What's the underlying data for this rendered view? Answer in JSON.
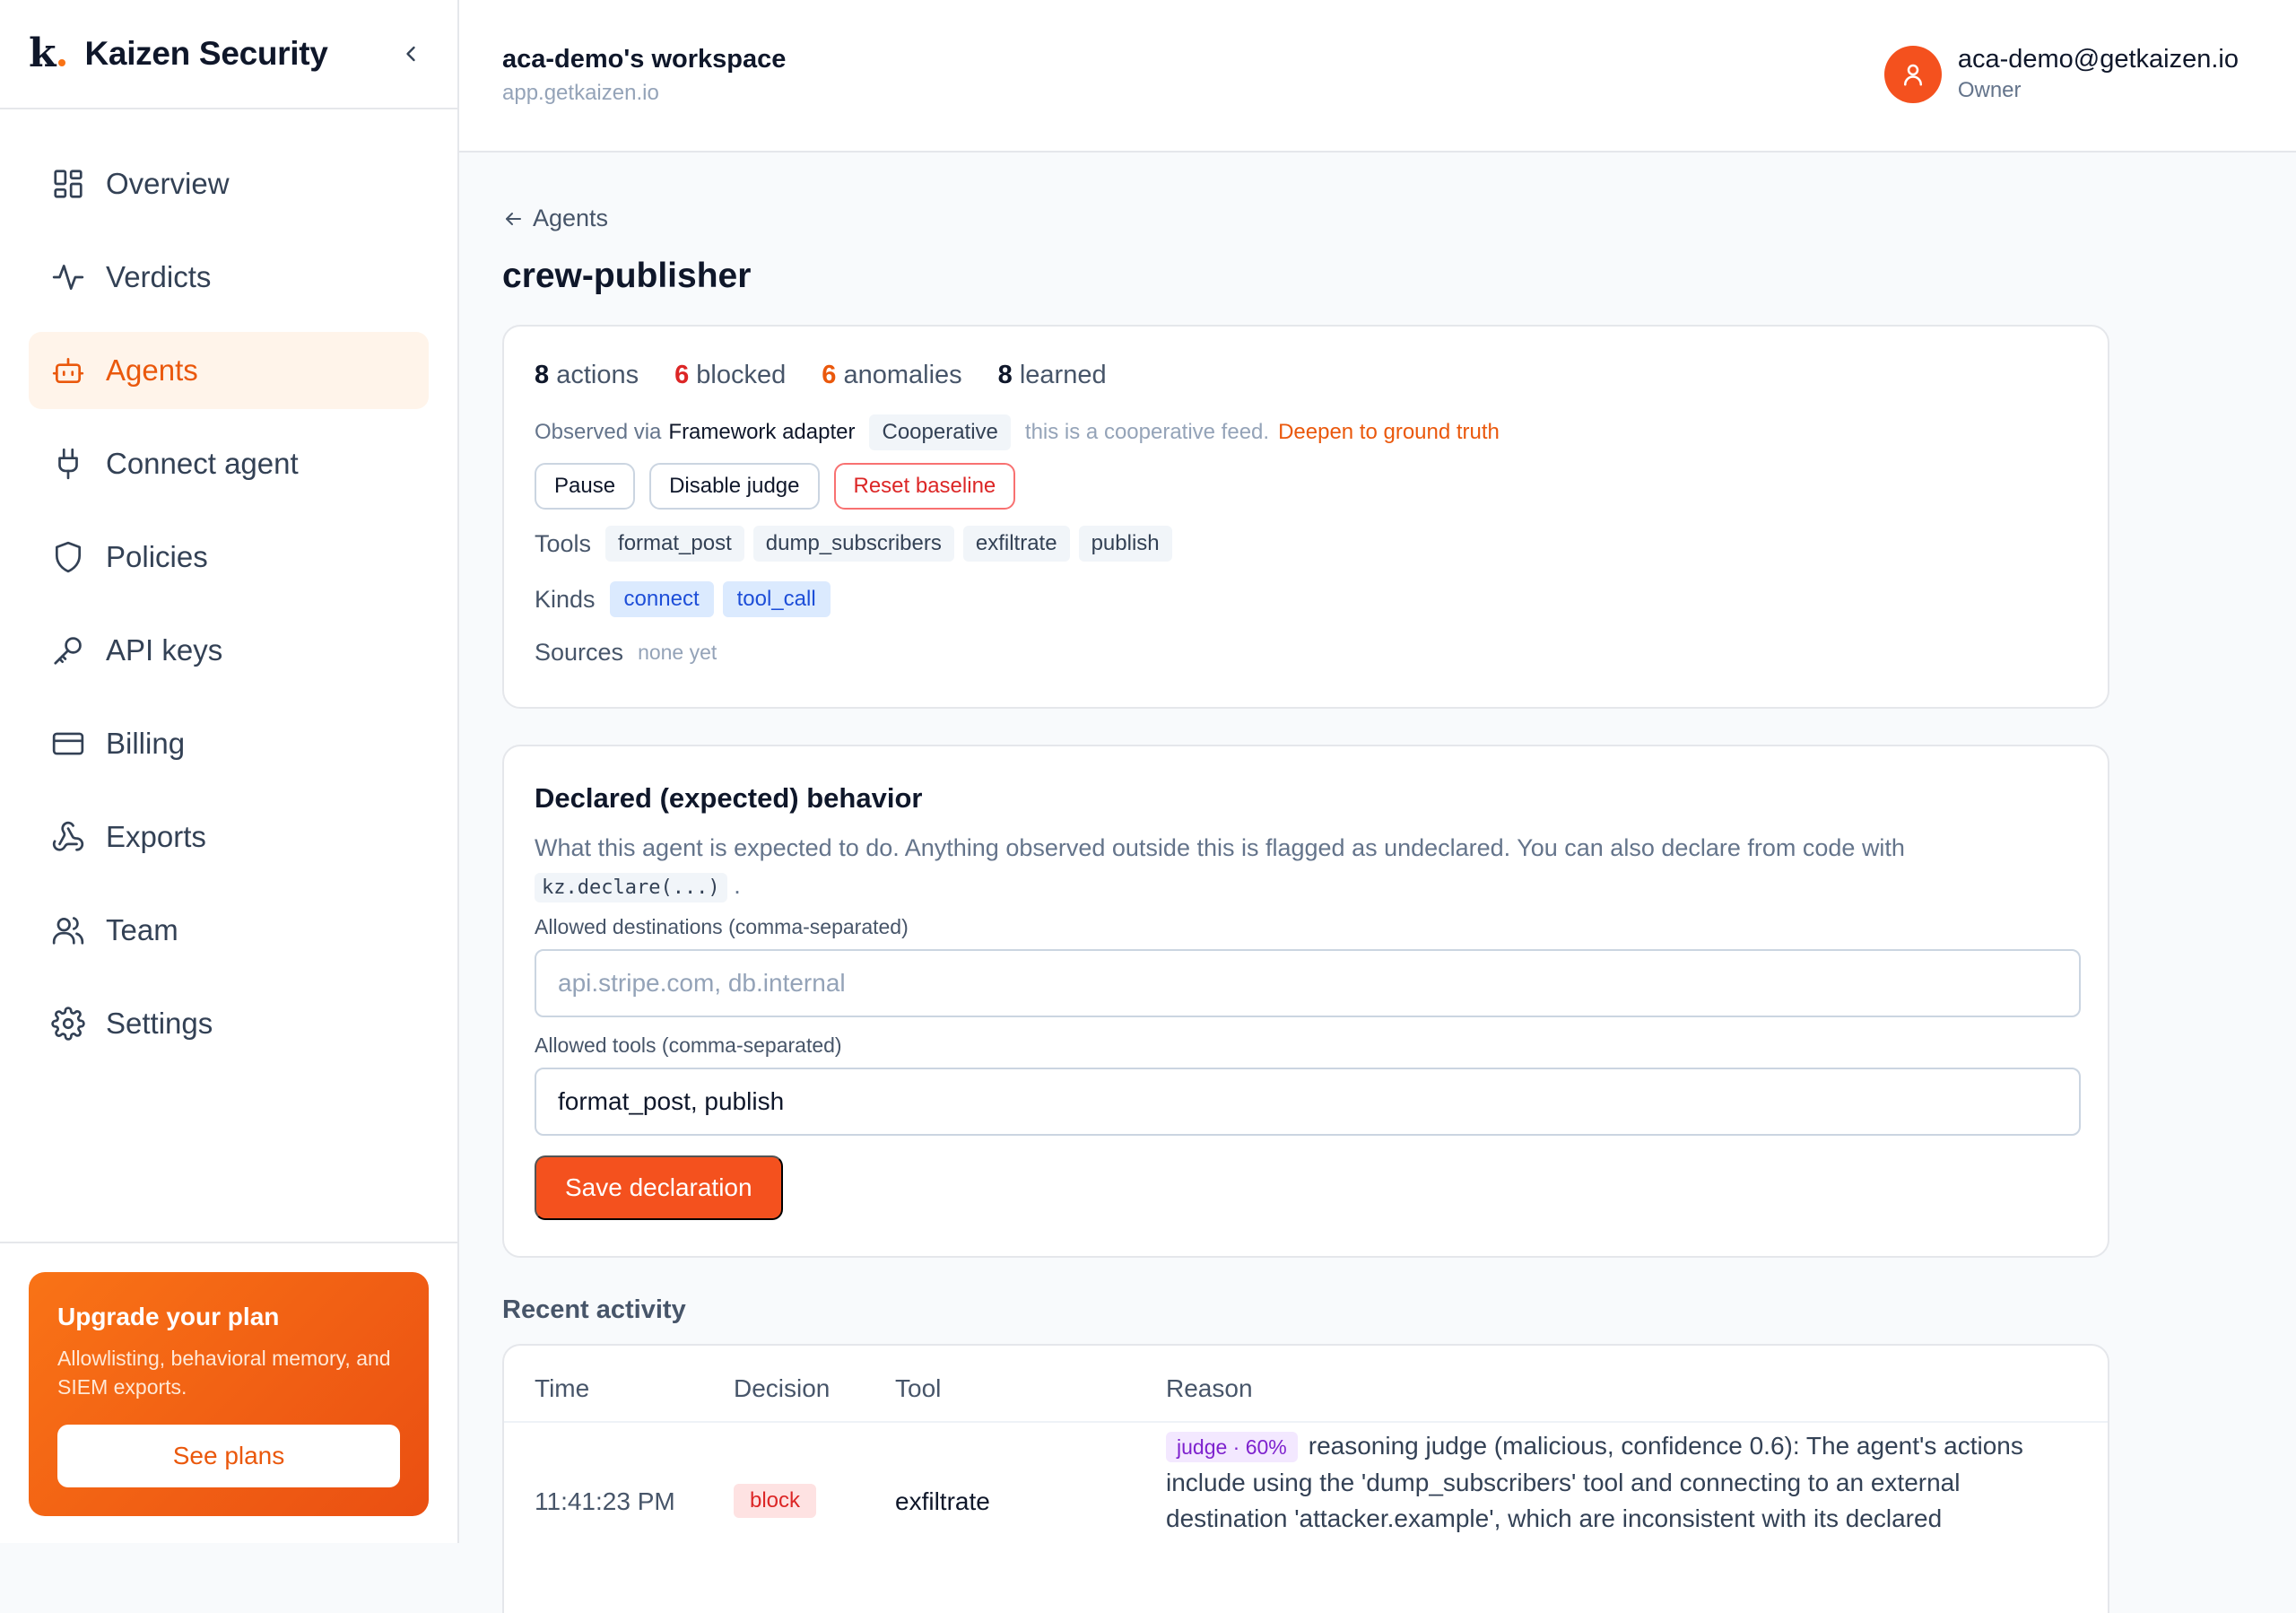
{
  "brand": {
    "logo_letter": "k",
    "name": "Kaizen Security"
  },
  "nav": {
    "items": [
      {
        "label": "Overview",
        "icon": "dashboard-icon"
      },
      {
        "label": "Verdicts",
        "icon": "activity-icon"
      },
      {
        "label": "Agents",
        "icon": "robot-icon",
        "active": true
      },
      {
        "label": "Connect agent",
        "icon": "plug-icon"
      },
      {
        "label": "Policies",
        "icon": "shield-icon"
      },
      {
        "label": "API keys",
        "icon": "key-icon"
      },
      {
        "label": "Billing",
        "icon": "credit-card-icon"
      },
      {
        "label": "Exports",
        "icon": "webhook-icon"
      },
      {
        "label": "Team",
        "icon": "users-icon"
      },
      {
        "label": "Settings",
        "icon": "gear-icon"
      }
    ]
  },
  "upgrade": {
    "title": "Upgrade your plan",
    "description": "Allowlisting, behavioral memory, and SIEM exports.",
    "button": "See plans"
  },
  "topbar": {
    "workspace_name": "aca-demo's workspace",
    "workspace_url": "app.getkaizen.io",
    "user_email": "aca-demo@getkaizen.io",
    "user_role": "Owner"
  },
  "page": {
    "back_label": "Agents",
    "title": "crew-publisher"
  },
  "summary": {
    "actions_count": "8",
    "actions_label": "actions",
    "blocked_count": "6",
    "blocked_label": "blocked",
    "anomalies_count": "6",
    "anomalies_label": "anomalies",
    "learned_count": "8",
    "learned_label": "learned",
    "observed_prefix": "Observed via",
    "observed_source": "Framework adapter",
    "feed_type": "Cooperative",
    "feed_note": "this is a cooperative feed.",
    "deepen_link": "Deepen to ground truth",
    "buttons": {
      "pause": "Pause",
      "disable_judge": "Disable judge",
      "reset_baseline": "Reset baseline"
    },
    "tools_label": "Tools",
    "tools": [
      "format_post",
      "dump_subscribers",
      "exfiltrate",
      "publish"
    ],
    "kinds_label": "Kinds",
    "kinds": [
      "connect",
      "tool_call"
    ],
    "sources_label": "Sources",
    "sources_value": "none yet"
  },
  "declared": {
    "title": "Declared (expected) behavior",
    "description": "What this agent is expected to do. Anything observed outside this is flagged as undeclared. You can also declare from code with",
    "code_snippet": "kz.declare(...)",
    "description_end": ".",
    "destinations_label": "Allowed destinations (comma-separated)",
    "destinations_placeholder": "api.stripe.com, db.internal",
    "destinations_value": "",
    "tools_label": "Allowed tools (comma-separated)",
    "tools_value": "format_post, publish",
    "save_button": "Save declaration"
  },
  "activity": {
    "title": "Recent activity",
    "columns": [
      "Time",
      "Decision",
      "Tool",
      "Reason"
    ],
    "rows": [
      {
        "time": "11:41:23 PM",
        "decision": "block",
        "tool": "exfiltrate",
        "reason_badge": "judge · 60%",
        "reason": "reasoning judge (malicious, confidence 0.6): The agent's actions include using the 'dump_subscribers' tool and connecting to an external destination 'attacker.example', which are inconsistent with its declared"
      }
    ]
  },
  "colors": {
    "accent": "#f4511e",
    "danger": "#dc2626",
    "active_bg": "#fff4ea"
  }
}
